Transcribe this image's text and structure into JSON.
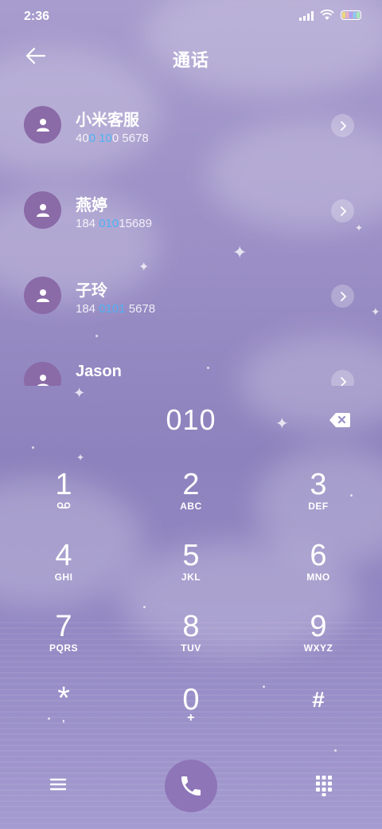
{
  "status_bar": {
    "time": "2:36",
    "battery_colors": [
      "#f0d878",
      "#f2b0c0",
      "#b0a0f0",
      "#88ccf0",
      "#a8e8b8"
    ]
  },
  "header": {
    "title": "通话",
    "back_icon": "arrow-left-icon"
  },
  "contacts": [
    {
      "name": "小米客服",
      "number_parts": [
        "40",
        "0 10",
        "0 5678"
      ]
    },
    {
      "name": "燕婷",
      "number_parts": [
        "184 ",
        "010",
        "15689"
      ]
    },
    {
      "name": "子玲",
      "number_parts": [
        "184 ",
        "0101",
        " 5678"
      ]
    },
    {
      "name": "Jason",
      "number_parts": [
        "",
        "",
        ""
      ]
    }
  ],
  "highlight_color": "#4fb2f5",
  "dialer": {
    "number": "010",
    "backspace_icon": "backspace-icon"
  },
  "keypad": [
    {
      "digit": "1",
      "letters": "voicemail-icon"
    },
    {
      "digit": "2",
      "letters": "ABC"
    },
    {
      "digit": "3",
      "letters": "DEF"
    },
    {
      "digit": "4",
      "letters": "GHI"
    },
    {
      "digit": "5",
      "letters": "JKL"
    },
    {
      "digit": "6",
      "letters": "MNO"
    },
    {
      "digit": "7",
      "letters": "PQRS"
    },
    {
      "digit": "8",
      "letters": "TUV"
    },
    {
      "digit": "9",
      "letters": "WXYZ"
    },
    {
      "digit": "*",
      "letters": ","
    },
    {
      "digit": "0",
      "letters": "+"
    },
    {
      "digit": "#",
      "letters": ""
    }
  ],
  "bottom_bar": {
    "menu_icon": "menu-icon",
    "call_icon": "phone-icon",
    "keypad_icon": "keypad-grid-icon",
    "call_button_color": "#8e75b8"
  }
}
